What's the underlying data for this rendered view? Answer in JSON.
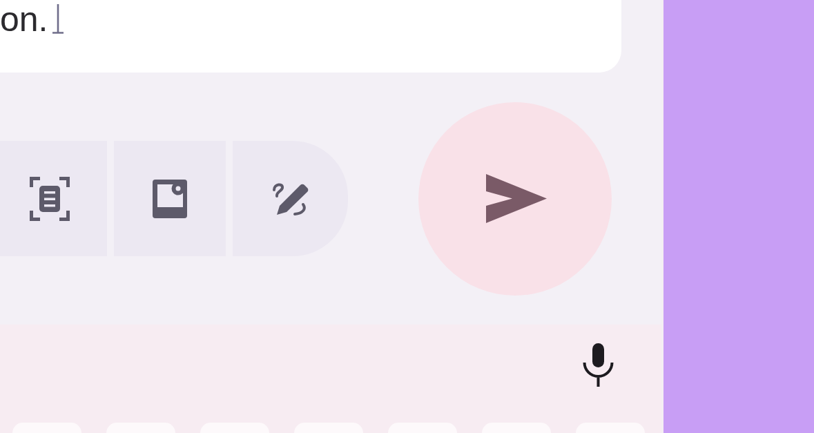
{
  "message_field": {
    "value": "on."
  }
}
